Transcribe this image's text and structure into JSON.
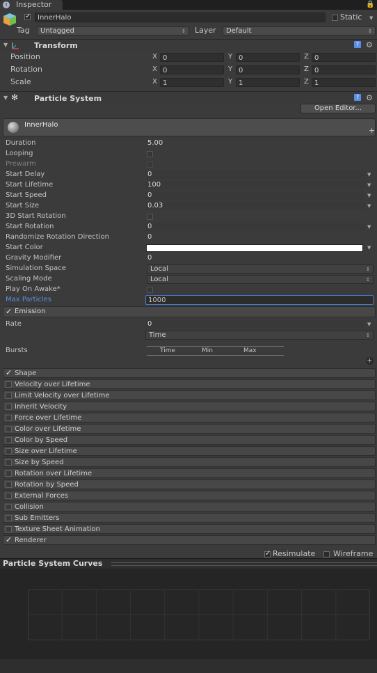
{
  "tab": {
    "label": "Inspector",
    "icon": "info-icon"
  },
  "header": {
    "object_name": "InnerHalo",
    "static_label": "Static",
    "tag_label": "Tag",
    "tag_value": "Untagged",
    "layer_label": "Layer",
    "layer_value": "Default"
  },
  "transform": {
    "title": "Transform",
    "rows": [
      {
        "label": "Position",
        "x": "0",
        "y": "0",
        "z": "0"
      },
      {
        "label": "Rotation",
        "x": "0",
        "y": "0",
        "z": "0"
      },
      {
        "label": "Scale",
        "x": "1",
        "y": "1",
        "z": "1"
      }
    ],
    "axis_x": "X",
    "axis_y": "Y",
    "axis_z": "Z"
  },
  "particle_system": {
    "title": "Particle System",
    "open_editor_label": "Open Editor...",
    "system_name": "InnerHalo",
    "props": [
      {
        "label": "Duration",
        "value": "5.00"
      },
      {
        "label": "Looping",
        "value": ""
      },
      {
        "label": "Prewarm",
        "value": ""
      },
      {
        "label": "Start Delay",
        "value": "0"
      },
      {
        "label": "Start Lifetime",
        "value": "100"
      },
      {
        "label": "Start Speed",
        "value": "0"
      },
      {
        "label": "Start Size",
        "value": "0.03"
      },
      {
        "label": "3D Start Rotation",
        "value": ""
      },
      {
        "label": "Start Rotation",
        "value": "0"
      },
      {
        "label": "Randomize Rotation Direction",
        "value": "0"
      },
      {
        "label": "Start Color",
        "value": ""
      },
      {
        "label": "Gravity Modifier",
        "value": "0"
      },
      {
        "label": "Simulation Space",
        "value": "Local"
      },
      {
        "label": "Scaling Mode",
        "value": "Local"
      },
      {
        "label": "Play On Awake*",
        "value": ""
      },
      {
        "label": "Max Particles",
        "value": "1000"
      }
    ],
    "emission": {
      "label": "Emission",
      "rate_label": "Rate",
      "rate_value": "0",
      "rate_mode": "Time",
      "bursts_label": "Bursts",
      "bursts_cols": [
        "Time",
        "Min",
        "Max"
      ]
    },
    "modules": [
      {
        "label": "Shape",
        "enabled": true
      },
      {
        "label": "Velocity over Lifetime",
        "enabled": false
      },
      {
        "label": "Limit Velocity over Lifetime",
        "enabled": false
      },
      {
        "label": "Inherit Velocity",
        "enabled": false
      },
      {
        "label": "Force over Lifetime",
        "enabled": false
      },
      {
        "label": "Color over Lifetime",
        "enabled": false
      },
      {
        "label": "Color by Speed",
        "enabled": false
      },
      {
        "label": "Size over Lifetime",
        "enabled": false
      },
      {
        "label": "Size by Speed",
        "enabled": false
      },
      {
        "label": "Rotation over Lifetime",
        "enabled": false
      },
      {
        "label": "Rotation by Speed",
        "enabled": false
      },
      {
        "label": "External Forces",
        "enabled": false
      },
      {
        "label": "Collision",
        "enabled": false
      },
      {
        "label": "Sub Emitters",
        "enabled": false
      },
      {
        "label": "Texture Sheet Animation",
        "enabled": false
      },
      {
        "label": "Renderer",
        "enabled": true
      }
    ],
    "resimulate_label": "Resimulate",
    "wireframe_label": "Wireframe"
  },
  "curves": {
    "title": "Particle System Curves"
  },
  "colors": {
    "accent": "#5a8ee6",
    "panel": "#3b3b3b",
    "field": "#2f2f2f"
  }
}
